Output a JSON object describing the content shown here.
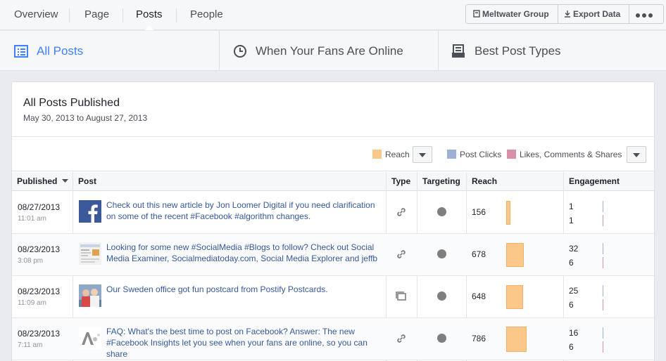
{
  "nav": {
    "tabs": [
      {
        "label": "Overview"
      },
      {
        "label": "Page"
      },
      {
        "label": "Posts"
      },
      {
        "label": "People"
      }
    ],
    "meltwater_label": "Meltwater Group",
    "export_label": "Export Data"
  },
  "subtabs": [
    {
      "label": "All Posts",
      "icon": "list-icon"
    },
    {
      "label": "When Your Fans Are Online",
      "icon": "clock-icon"
    },
    {
      "label": "Best Post Types",
      "icon": "post-types-icon"
    }
  ],
  "card": {
    "title": "All Posts Published",
    "subtitle": "May 30, 2013 to August 27, 2013"
  },
  "legend": {
    "reach": "Reach",
    "post_clicks": "Post Clicks",
    "engagement": "Likes, Comments & Shares",
    "colors": {
      "reach": "#fcc88a",
      "post_clicks": "#9fb0d6",
      "engagement": "#d98fa8"
    }
  },
  "columns": {
    "published": "Published",
    "post": "Post",
    "type": "Type",
    "targeting": "Targeting",
    "reach": "Reach",
    "engagement": "Engagement"
  },
  "rows": [
    {
      "date": "08/27/2013",
      "time": "11:01 am",
      "text": "Check out this new article by Jon Loomer Digital if you need clarification on some of the recent #Facebook #algorithm changes.",
      "thumb": "facebook-logo-thumb",
      "type": "link-icon",
      "reach": "156",
      "reach_fraction": 0.2,
      "clicks": "1",
      "likes": "1"
    },
    {
      "date": "08/23/2013",
      "time": "3:08 pm",
      "text": "Looking for some new #SocialMedia #Blogs to follow? Check out Social Media Examiner, Socialmediatoday.com, Social Media Explorer and jeffb",
      "thumb": "webpage-thumb",
      "type": "link-icon",
      "reach": "678",
      "reach_fraction": 0.86,
      "clicks": "32",
      "likes": "6"
    },
    {
      "date": "08/23/2013",
      "time": "11:09 am",
      "text": "Our Sweden office got fun postcard from Postify Postcards.",
      "thumb": "photo-thumb",
      "type": "photo-type-icon",
      "reach": "648",
      "reach_fraction": 0.82,
      "clicks": "25",
      "likes": "6"
    },
    {
      "date": "08/23/2013",
      "time": "7:11 am",
      "text": "FAQ: What's the best time to post on Facebook? Answer: The new #Facebook Insights let you see when your fans are online, so you can share",
      "thumb": "logo-thumb",
      "type": "link-icon",
      "reach": "786",
      "reach_fraction": 1.0,
      "clicks": "16",
      "likes": "6"
    }
  ]
}
